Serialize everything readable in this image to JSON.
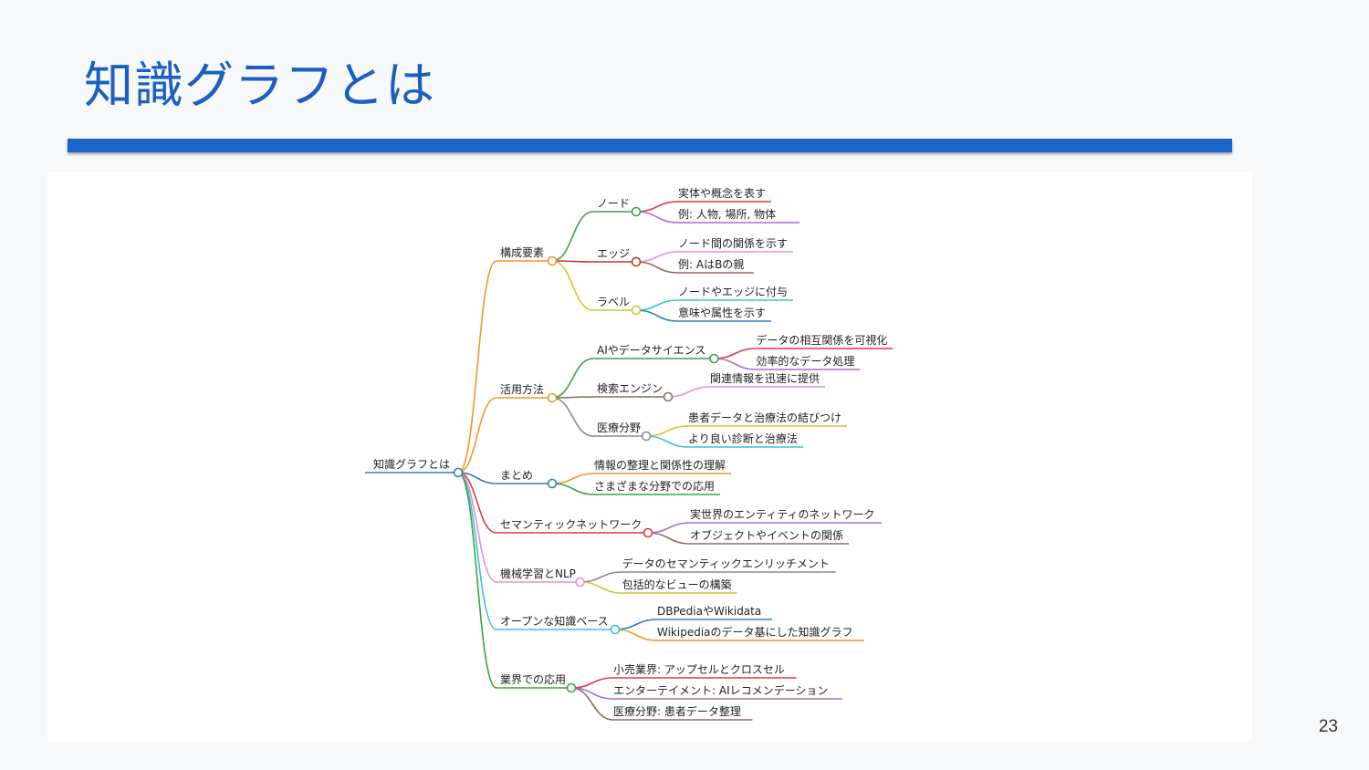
{
  "slide": {
    "title": "知識グラフとは",
    "page_number": "23"
  },
  "mindmap": {
    "root": "知識グラフとは",
    "branches": [
      {
        "label": "構成要素",
        "color": "#f0962c",
        "children": [
          {
            "label": "ノード",
            "color": "#3aa345",
            "leaves": [
              {
                "label": "実体や概念を表す",
                "color": "#e03a3a"
              },
              {
                "label": "例: 人物, 場所, 物体",
                "color": "#a96bd6"
              }
            ]
          },
          {
            "label": "エッジ",
            "color": "#c0392b",
            "leaves": [
              {
                "label": "ノード間の関係を示す",
                "color": "#e88fd9"
              },
              {
                "label": "例: AはBの親",
                "color": "#8a6e62"
              }
            ]
          },
          {
            "label": "ラベル",
            "color": "#d8c22f",
            "leaves": [
              {
                "label": "ノードやエッジに付与",
                "color": "#3bc3d8"
              },
              {
                "label": "意味や属性を示す",
                "color": "#2e7fb8"
              }
            ]
          }
        ]
      },
      {
        "label": "活用方法",
        "color": "#f0962c",
        "children": [
          {
            "label": "AIやデータサイエンス",
            "color": "#3aa345",
            "leaves": [
              {
                "label": "データの相互関係を可視化",
                "color": "#e03a3a"
              },
              {
                "label": "効率的なデータ処理",
                "color": "#a96bd6"
              }
            ]
          },
          {
            "label": "検索エンジン",
            "color": "#8a6e62",
            "leaves": [
              {
                "label": "関連情報を迅速に提供",
                "color": "#e88fd9"
              }
            ]
          },
          {
            "label": "医療分野",
            "color": "#8a8a8a",
            "leaves": [
              {
                "label": "患者データと治療法の結びつけ",
                "color": "#d8c22f"
              },
              {
                "label": "より良い診断と治療法",
                "color": "#3bc3d8"
              }
            ]
          }
        ]
      },
      {
        "label": "まとめ",
        "color": "#2e7fb8",
        "leaves": [
          {
            "label": "情報の整理と関係性の理解",
            "color": "#f0962c"
          },
          {
            "label": "さまざまな分野での応用",
            "color": "#3aa345"
          }
        ]
      },
      {
        "label": "セマンティックネットワーク",
        "color": "#e03a3a",
        "leaves": [
          {
            "label": "実世界のエンティティのネットワーク",
            "color": "#a96bd6"
          },
          {
            "label": "オブジェクトやイベントの関係",
            "color": "#8a6e62"
          }
        ]
      },
      {
        "label": "機械学習とNLP",
        "color": "#e88fd9",
        "leaves": [
          {
            "label": "データのセマンティックエンリッチメント",
            "color": "#8a8a8a"
          },
          {
            "label": "包括的なビューの構築",
            "color": "#d8c22f"
          }
        ]
      },
      {
        "label": "オープンな知識ベース",
        "color": "#3bc3d8",
        "leaves": [
          {
            "label": "DBPediaやWikidata",
            "color": "#2e7fb8"
          },
          {
            "label": "Wikipediaのデータ基にした知識グラフ",
            "color": "#f0962c"
          }
        ]
      },
      {
        "label": "業界での応用",
        "color": "#3aa345",
        "leaves": [
          {
            "label": "小売業界: アップセルとクロスセル",
            "color": "#e03a3a"
          },
          {
            "label": "エンターテイメント: AIレコメンデーション",
            "color": "#a96bd6"
          },
          {
            "label": "医療分野: 患者データ整理",
            "color": "#8a6e62"
          }
        ]
      }
    ]
  },
  "colors": {
    "title": "#1a5fc1",
    "title_bar": "#1a63c7",
    "root_line": "#2e7fb8"
  }
}
